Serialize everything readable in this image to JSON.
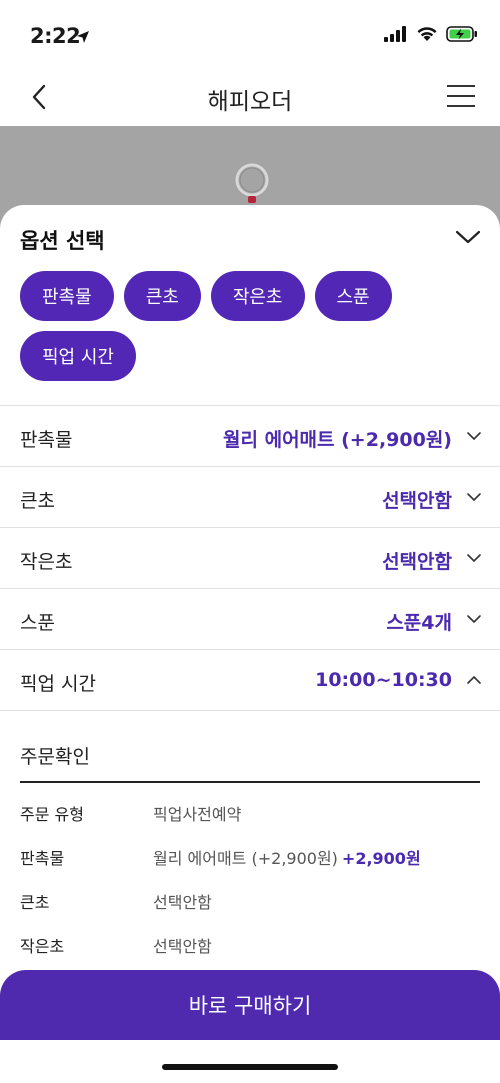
{
  "status_bar": {
    "time": "2:22",
    "icons": [
      "location-arrow-icon",
      "signal-icon",
      "wifi-icon",
      "battery-charging-icon"
    ]
  },
  "nav": {
    "title": "해피오더",
    "back_icon": "chevron-left-icon",
    "menu_icon": "hamburger-menu-icon"
  },
  "sheet": {
    "title": "옵션 선택",
    "collapse_icon": "chevron-down-icon",
    "chips": [
      "판촉물",
      "큰초",
      "작은초",
      "스푼",
      "픽업 시간"
    ],
    "options": [
      {
        "label": "판촉물",
        "value": "월리 에어매트 (+2,900원)",
        "arrow": "chevron-down-icon"
      },
      {
        "label": "큰초",
        "value": "선택안함",
        "arrow": "chevron-down-icon"
      },
      {
        "label": "작은초",
        "value": "선택안함",
        "arrow": "chevron-down-icon"
      },
      {
        "label": "스푼",
        "value": "스푼4개",
        "arrow": "chevron-down-icon"
      },
      {
        "label": "픽업 시간",
        "value": "10:00~10:30",
        "arrow": "chevron-up-icon"
      }
    ],
    "confirm": {
      "title": "주문확인",
      "rows": [
        {
          "label": "주문 유형",
          "value": "픽업사전예약",
          "price": ""
        },
        {
          "label": "판촉물",
          "value": "월리 에어매트 (+2,900원)",
          "price": "+2,900원"
        },
        {
          "label": "큰초",
          "value": "선택안함",
          "price": ""
        },
        {
          "label": "작은초",
          "value": "선택안함",
          "price": ""
        }
      ]
    }
  },
  "cta": {
    "label": "바로 구매하기"
  },
  "colors": {
    "accent": "#5227b5",
    "accent_text": "#4b2aae",
    "hero_bg": "#a4a4a4"
  }
}
